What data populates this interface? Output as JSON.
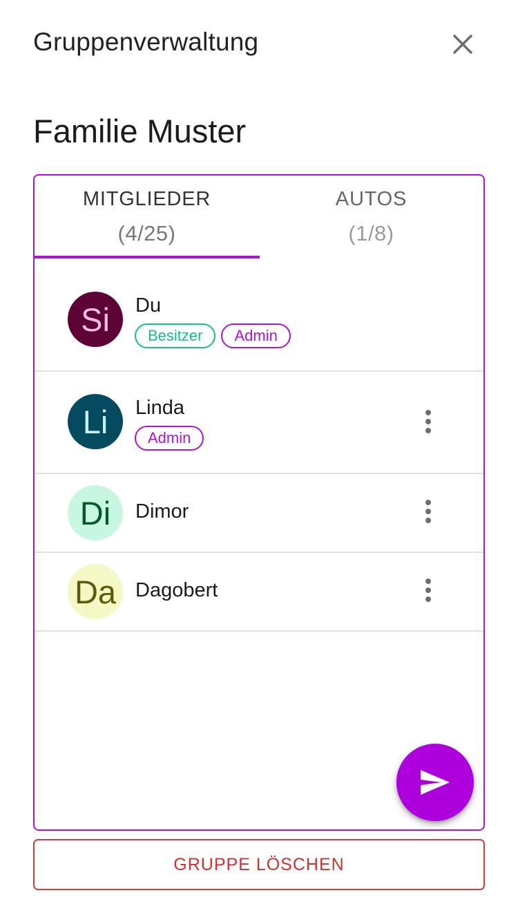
{
  "header": {
    "title": "Gruppenverwaltung",
    "close_icon": "close-icon"
  },
  "group": {
    "name": "Familie Muster"
  },
  "tabs": [
    {
      "label": "MITGLIEDER",
      "count": "(4/25)",
      "active": true
    },
    {
      "label": "AUTOS",
      "count": "(1/8)",
      "active": false
    }
  ],
  "members": [
    {
      "initials": "Si",
      "name": "Du",
      "avatar_bg": "#5d0335",
      "avatar_fg": "#f8bedc",
      "badges": [
        {
          "label": "Besitzer",
          "color": "#11c08a"
        },
        {
          "label": "Admin",
          "color": "#ad12d6"
        }
      ],
      "has_menu": false
    },
    {
      "initials": "Li",
      "name": "Linda",
      "avatar_bg": "#044b5f",
      "avatar_fg": "#c9eef8",
      "badges": [
        {
          "label": "Admin",
          "color": "#ad12d6"
        }
      ],
      "has_menu": true
    },
    {
      "initials": "Di",
      "name": "Dimor",
      "avatar_bg": "#c8f7e1",
      "avatar_fg": "#06582c",
      "badges": [],
      "has_menu": true
    },
    {
      "initials": "Da",
      "name": "Dagobert",
      "avatar_bg": "#f4f8c5",
      "avatar_fg": "#5a5c07",
      "badges": [],
      "has_menu": true
    }
  ],
  "fab": {
    "icon": "send-icon",
    "color": "#ad00dc"
  },
  "delete_button": {
    "label": "GRUPPE LÖSCHEN",
    "color": "#d32f2f"
  },
  "accent_color": "#ad12d6"
}
